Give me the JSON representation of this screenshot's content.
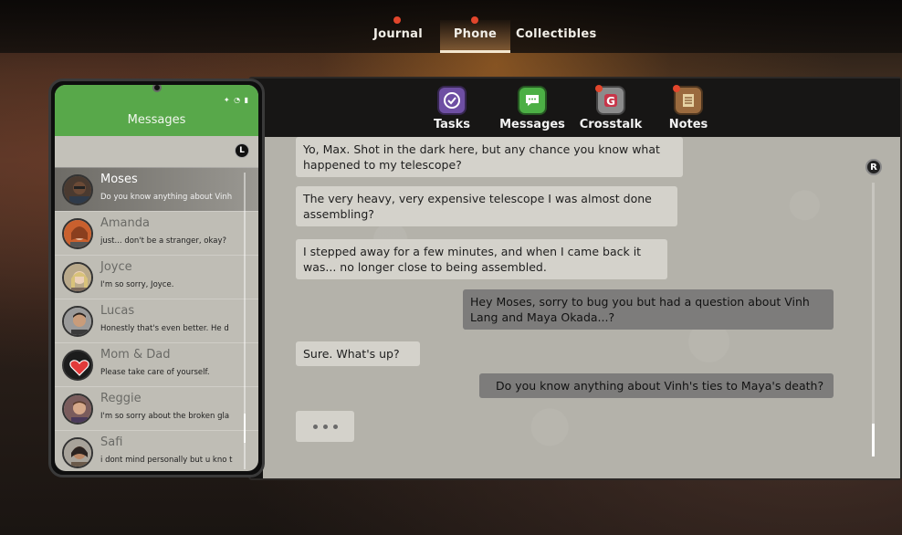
{
  "top_tabs": [
    {
      "label": "Journal",
      "notify": true
    },
    {
      "label": "Phone",
      "notify": true,
      "active": true
    },
    {
      "label": "Collectibles",
      "notify": false
    }
  ],
  "apps": [
    {
      "label": "Tasks",
      "icon": "checkmark-icon",
      "color": "#6e4fa3",
      "notify": false
    },
    {
      "label": "Messages",
      "icon": "chat-bubble-icon",
      "color": "#4caf45",
      "notify": false
    },
    {
      "label": "Crosstalk",
      "icon": "crosstalk-icon",
      "color": "#8b8b8b",
      "notify": true
    },
    {
      "label": "Notes",
      "icon": "notepad-icon",
      "color": "#9a6a3e",
      "notify": true
    }
  ],
  "phone": {
    "title": "Messages",
    "status": "✦ ◔ ▮",
    "button_hint": "L"
  },
  "contacts": [
    {
      "name": "Moses",
      "preview": "Do you know anything about Vinh",
      "active": true
    },
    {
      "name": "Amanda",
      "preview": "just... don't be a stranger, okay?",
      "active": false
    },
    {
      "name": "Joyce",
      "preview": "I'm so sorry, Joyce.",
      "active": false
    },
    {
      "name": "Lucas",
      "preview": "Honestly that's even better. He d",
      "active": false
    },
    {
      "name": "Mom & Dad",
      "preview": "Please take care of yourself.",
      "active": false
    },
    {
      "name": "Reggie",
      "preview": "I'm so sorry about the broken gla",
      "active": false
    },
    {
      "name": "Safi",
      "preview": "i dont mind personally but u kno t",
      "active": false
    }
  ],
  "messages": [
    {
      "from": "in",
      "text": "Yo, Max. Shot in the dark here, but any chance you know what happened to my telescope?"
    },
    {
      "from": "in",
      "text": "The very heavy, very expensive telescope I was almost done assembling?"
    },
    {
      "from": "in",
      "text": "I stepped away for a few minutes, and when I came back it was... no longer close to being assembled."
    },
    {
      "from": "out",
      "text": "Hey Moses, sorry to bug you but had a question about Vinh Lang and Maya Okada...?"
    },
    {
      "from": "in",
      "text": "Sure. What's up?"
    },
    {
      "from": "out",
      "text": "Do you know anything about Vinh's ties to Maya's death?"
    }
  ],
  "chat_button_hint": "R",
  "colors": {
    "accent_green": "#58a84a",
    "notify_red": "#e2462c"
  }
}
